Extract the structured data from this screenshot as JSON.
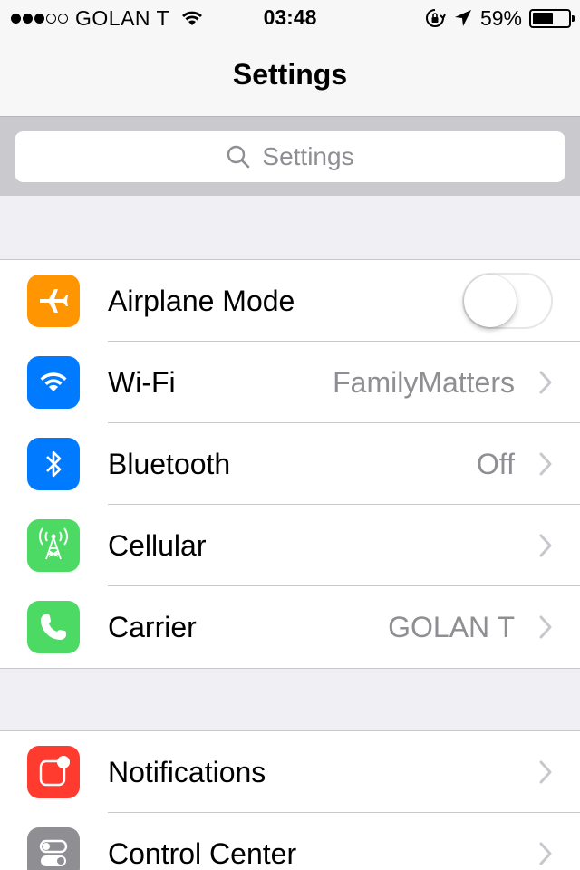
{
  "status_bar": {
    "signal": "●●●○○",
    "carrier": "GOLAN T",
    "time": "03:48",
    "battery_percent": "59%",
    "battery_level": 0.59,
    "icons": [
      "wifi-icon",
      "orientation-lock-icon",
      "location-arrow-icon",
      "battery-icon"
    ]
  },
  "nav": {
    "title": "Settings"
  },
  "search": {
    "placeholder": "Settings"
  },
  "groups": [
    {
      "rows": [
        {
          "label": "Airplane Mode",
          "icon": "airplane-icon",
          "icon_color": "#ff9500",
          "toggle": false
        },
        {
          "label": "Wi-Fi",
          "value": "FamilyMatters",
          "icon": "wifi-icon",
          "icon_color": "#007aff"
        },
        {
          "label": "Bluetooth",
          "value": "Off",
          "icon": "bluetooth-icon",
          "icon_color": "#007aff"
        },
        {
          "label": "Cellular",
          "icon": "cellular-antenna-icon",
          "icon_color": "#4cd964"
        },
        {
          "label": "Carrier",
          "value": "GOLAN T",
          "icon": "phone-icon",
          "icon_color": "#4cd964"
        }
      ]
    },
    {
      "rows": [
        {
          "label": "Notifications",
          "icon": "notifications-icon",
          "icon_color": "#ff3b30"
        },
        {
          "label": "Control Center",
          "icon": "control-center-icon",
          "icon_color": "#8e8e93"
        }
      ]
    }
  ]
}
